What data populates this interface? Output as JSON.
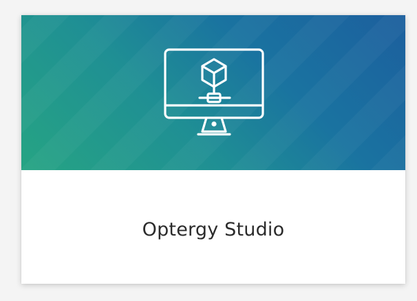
{
  "tile": {
    "title": "Optergy Studio",
    "icon": "monitor-cube-icon",
    "colors": {
      "gradient_start": "#26a483",
      "gradient_end": "#1c5f9e",
      "label_text": "#2b2b2b",
      "icon_stroke": "#ffffff"
    }
  }
}
